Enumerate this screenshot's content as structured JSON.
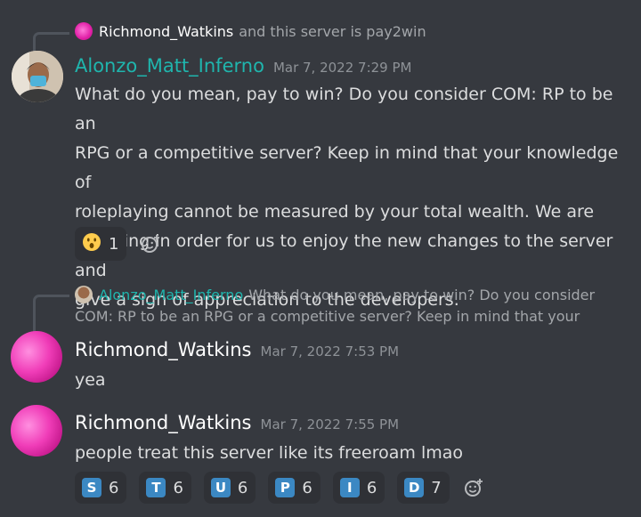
{
  "messages": [
    {
      "reply": {
        "name": "Richmond_Watkins",
        "text": "and this server is pay2win"
      },
      "author": "Alonzo_Matt_Inferno",
      "timestamp": "Mar 7, 2022 7:29 PM",
      "lines": [
        "What do you mean, pay to win? Do you consider COM: RP to be an",
        "RPG or a competitive server? Keep in mind that your knowledge of",
        "roleplaying cannot be measured by your total wealth. We are",
        "donating in order for us to enjoy the new changes to the server and",
        "give a sign of appreciation to the developers."
      ],
      "reactions": [
        {
          "emoji": "hushed-face-emoji",
          "count": "1"
        }
      ]
    },
    {
      "reply": {
        "name": "Alonzo_Matt_Inferno",
        "line1": "What do you mean, pay to win? Do you consider",
        "line2": "COM: RP to be an RPG or a competitive server? Keep in mind that your"
      },
      "author": "Richmond_Watkins",
      "timestamp": "Mar 7, 2022 7:53 PM",
      "text": "yea"
    },
    {
      "author": "Richmond_Watkins",
      "timestamp": "Mar 7, 2022 7:55 PM",
      "text": "people treat this server like its freeroam lmao",
      "reactions": [
        {
          "letter": "S",
          "count": "6"
        },
        {
          "letter": "T",
          "count": "6"
        },
        {
          "letter": "U",
          "count": "6"
        },
        {
          "letter": "P",
          "count": "6"
        },
        {
          "letter": "I",
          "count": "6"
        },
        {
          "letter": "D",
          "count": "7"
        }
      ]
    }
  ],
  "colors": {
    "background": "#36393f",
    "teal_name": "#1fb5ad",
    "letter_tile": "#3b88c3",
    "reaction_bg": "#2f3136"
  }
}
